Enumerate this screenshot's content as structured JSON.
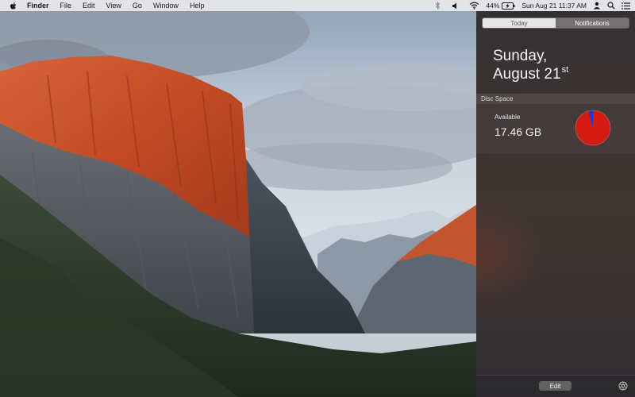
{
  "menubar": {
    "apple_icon": "apple-logo-icon",
    "items": [
      "Finder",
      "File",
      "Edit",
      "View",
      "Go",
      "Window",
      "Help"
    ],
    "status": {
      "bluetooth_icon": "bluetooth-icon",
      "volume_icon": "volume-icon",
      "wifi_icon": "wifi-icon",
      "battery_percent": "44%",
      "battery_icon": "battery-charging-icon",
      "datetime": "Sun Aug 21  11:37 AM",
      "user_icon": "user-icon",
      "spotlight_icon": "spotlight-search-icon",
      "notification_icon": "notification-center-icon"
    }
  },
  "notification_center": {
    "tabs": [
      {
        "label": "Today",
        "active": true
      },
      {
        "label": "Notifications",
        "active": false
      }
    ],
    "date": {
      "weekday": "Sunday,",
      "month_day": "August 21",
      "suffix": "st"
    },
    "widgets": [
      {
        "title": "Disc Space",
        "label": "Available",
        "value": "17.46 GB",
        "chart": {
          "used_fraction": 0.96,
          "free_fraction": 0.04,
          "used_color": "#d31b14",
          "free_color": "#2339c8"
        }
      }
    ],
    "edit_label": "Edit",
    "settings_icon": "gear-icon"
  },
  "colors": {
    "panel_bg": "#302c2e",
    "menubar_bg": "#e8e8ea",
    "pie_used": "#d31b14",
    "pie_free": "#2339c8"
  }
}
